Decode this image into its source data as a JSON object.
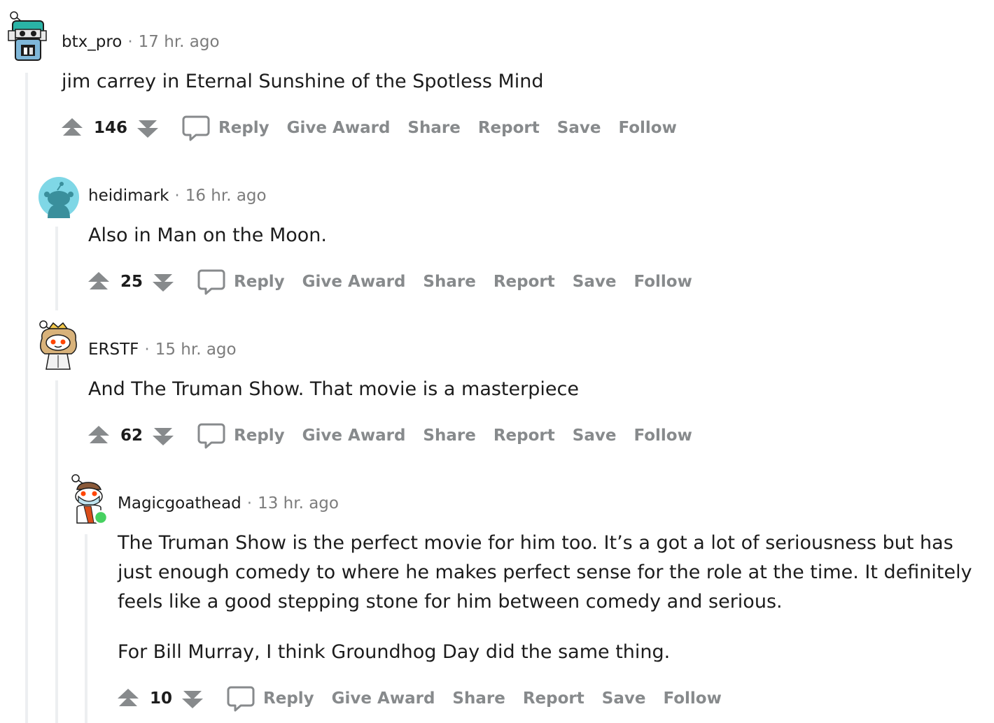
{
  "action_labels": {
    "reply": "Reply",
    "give_award": "Give Award",
    "share": "Share",
    "report": "Report",
    "save": "Save",
    "follow": "Follow"
  },
  "comments": [
    {
      "username": "btx_pro",
      "separator": "·",
      "time": "17 hr. ago",
      "paragraphs": [
        "jim carrey in Eternal Sunshine of the Spotless Mind"
      ],
      "score": "146",
      "avatar": "robot-snoo-avatar"
    },
    {
      "username": "heidimark",
      "separator": "·",
      "time": "16 hr. ago",
      "paragraphs": [
        "Also in Man on the Moon."
      ],
      "score": "25",
      "avatar": "default-snoo-avatar"
    },
    {
      "username": "ERSTF",
      "separator": "·",
      "time": "15 hr. ago",
      "paragraphs": [
        "And The Truman Show. That movie is a masterpiece"
      ],
      "score": "62",
      "avatar": "snoo-crown-avatar"
    },
    {
      "username": "Magicgoathead",
      "separator": "·",
      "time": "13 hr. ago",
      "paragraphs": [
        "The Truman Show is the perfect movie for him too. It’s a got a lot of seriousness but has just enough comedy to where he makes perfect sense for the role at the time. It definitely feels like a good stepping stone for him between comedy and serious.",
        "For Bill Murray, I think Groundhog Day did the same thing."
      ],
      "score": "10",
      "avatar": "snoo-mask-avatar",
      "online": true
    }
  ],
  "colors": {
    "thread_line": "#edeff1",
    "action_gray": "#878a8c",
    "text": "#1c1c1c",
    "online_green": "#46d160",
    "avatar_teal": "#7fd7e6"
  }
}
